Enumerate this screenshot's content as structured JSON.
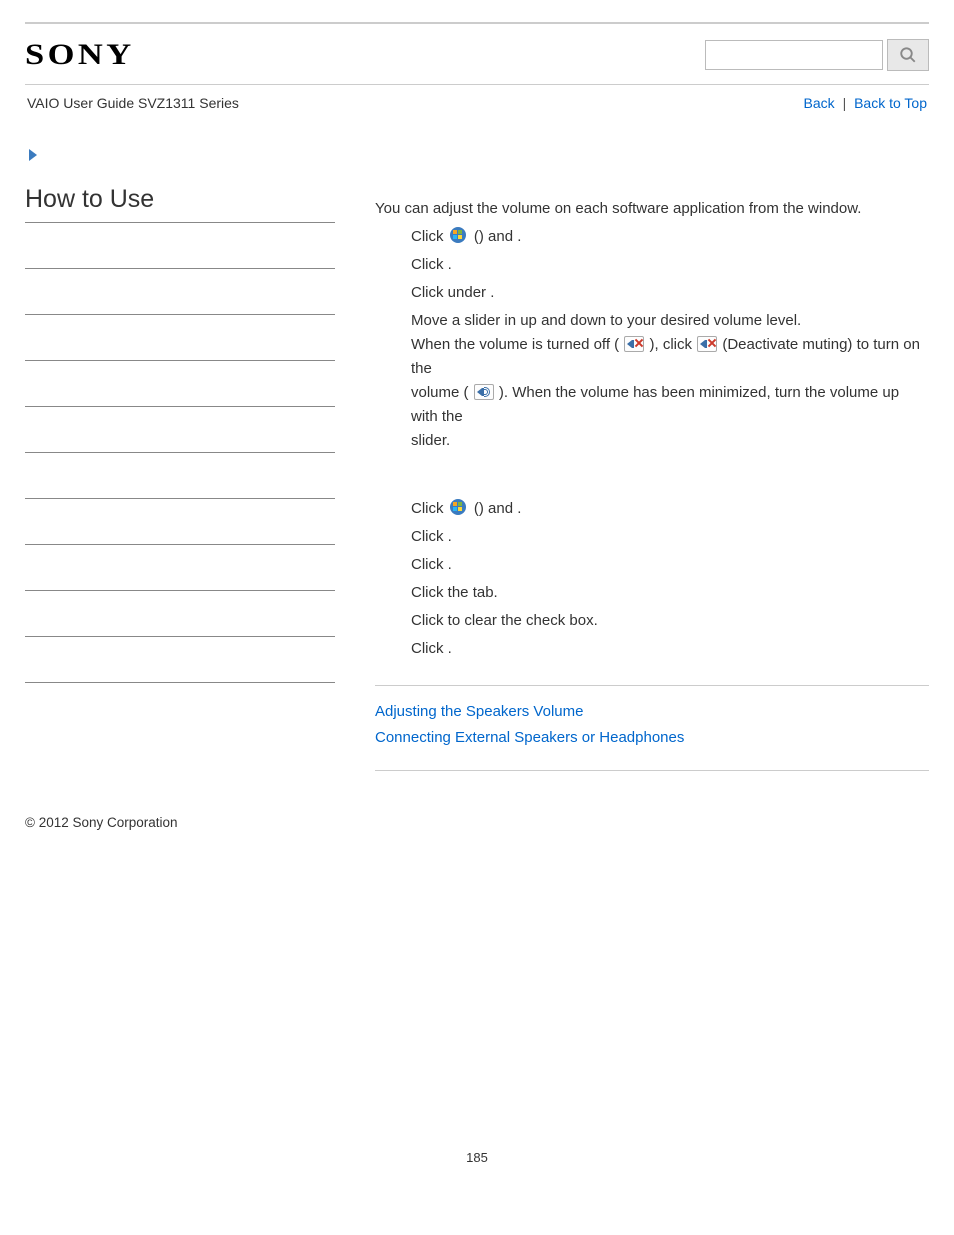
{
  "header": {
    "logo_text": "SONY",
    "search_placeholder": ""
  },
  "crumbs": {
    "guide": "VAIO User Guide SVZ1311 Series",
    "back": "Back",
    "back_to_top": "Back to Top"
  },
  "sidebar": {
    "title": "How to Use"
  },
  "main": {
    "intro_a": "You can adjust the volume on each software application from the ",
    "intro_b": " window.",
    "steps1": {
      "s1a": "Click ",
      "s1b": " (",
      "s1c": ") and ",
      "s1d": ".",
      "s2a": "Click ",
      "s2b": ".",
      "s3a": "Click ",
      "s3b": " under ",
      "s3c": ".",
      "s4a": "Move a slider in ",
      "s4b": " up and down to your desired volume level.",
      "s4c": "When the volume is turned off ( ",
      "s4d": " ), click ",
      "s4e": " (Deactivate muting) to turn on the",
      "s4f": "volume ( ",
      "s4g": " ). When the volume has been minimized, turn the volume up with the",
      "s4h": "slider."
    },
    "steps2": {
      "s1a": "Click ",
      "s1b": " (",
      "s1c": ") and ",
      "s1d": ".",
      "s2a": "Click ",
      "s2b": ".",
      "s3a": "Click ",
      "s3b": ".",
      "s4a": "Click the ",
      "s4b": " tab.",
      "s5a": "Click to clear the ",
      "s5b": " check box.",
      "s6a": "Click ",
      "s6b": "."
    },
    "related": {
      "r1": "Adjusting the Speakers Volume",
      "r2": "Connecting External Speakers or Headphones"
    }
  },
  "footer": {
    "copyright": "© 2012 Sony Corporation",
    "page_num": "185"
  }
}
